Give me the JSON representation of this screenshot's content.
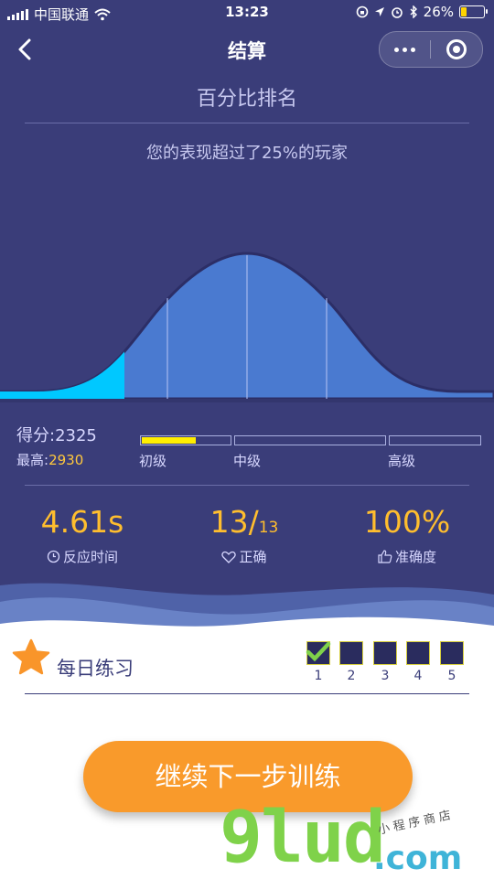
{
  "status_bar": {
    "carrier": "中国联通",
    "time": "13:23",
    "battery": "26%",
    "battery_level": 0.26
  },
  "nav": {
    "title": "结算"
  },
  "ranking": {
    "title": "百分比排名",
    "summary": "您的表现超过了25%的玩家",
    "percentile": 25
  },
  "score": {
    "label": "得分:2325",
    "best_label": "最高:",
    "best_value": "2930",
    "levels": [
      {
        "label": "初级",
        "fill": 0.62
      },
      {
        "label": "中级",
        "fill": 0
      },
      {
        "label": "高级",
        "fill": 0
      }
    ]
  },
  "stats": [
    {
      "value": "4.61s",
      "suffix": "",
      "label": "反应时间",
      "icon": "clock-icon"
    },
    {
      "value": "13/",
      "suffix": "13",
      "label": "正确",
      "icon": "heart-icon"
    },
    {
      "value": "100%",
      "suffix": "",
      "label": "准确度",
      "icon": "thumbs-up-icon"
    }
  ],
  "daily": {
    "label": "每日练习",
    "days": [
      "1",
      "2",
      "3",
      "4",
      "5"
    ],
    "completed": 1
  },
  "cta": {
    "label": "继续下一步训练"
  },
  "watermark": {
    "brand": "9lud",
    "suffix": ".com",
    "tagline": "小程序商店"
  },
  "colors": {
    "background": "#3a3d79",
    "accent": "#ffbe2e",
    "button": "#f99a2b",
    "highlight": "#00c8ff"
  }
}
